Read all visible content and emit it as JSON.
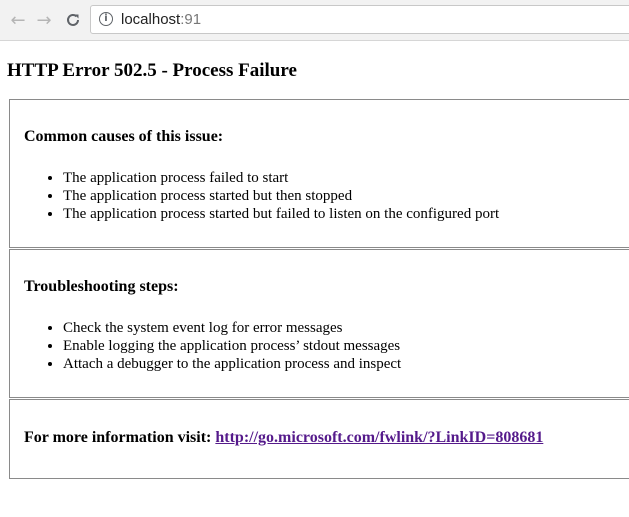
{
  "browser": {
    "url_host": "localhost",
    "url_port": ":91",
    "icons": {
      "back": "back-arrow-icon",
      "forward": "forward-arrow-icon",
      "reload": "reload-icon",
      "info": "info-icon"
    }
  },
  "page": {
    "title": "HTTP Error 502.5 - Process Failure",
    "causes": {
      "heading": "Common causes of this issue:",
      "items": [
        "The application process failed to start",
        "The application process started but then stopped",
        "The application process started but failed to listen on the configured port"
      ]
    },
    "steps": {
      "heading": "Troubleshooting steps:",
      "items": [
        "Check the system event log for error messages",
        "Enable logging the application process’ stdout messages",
        "Attach a debugger to the application process and inspect"
      ]
    },
    "more_info": {
      "label": "For more information visit: ",
      "link_text": "http://go.microsoft.com/fwlink/?LinkID=808681",
      "link_color": "#551a8b"
    }
  }
}
